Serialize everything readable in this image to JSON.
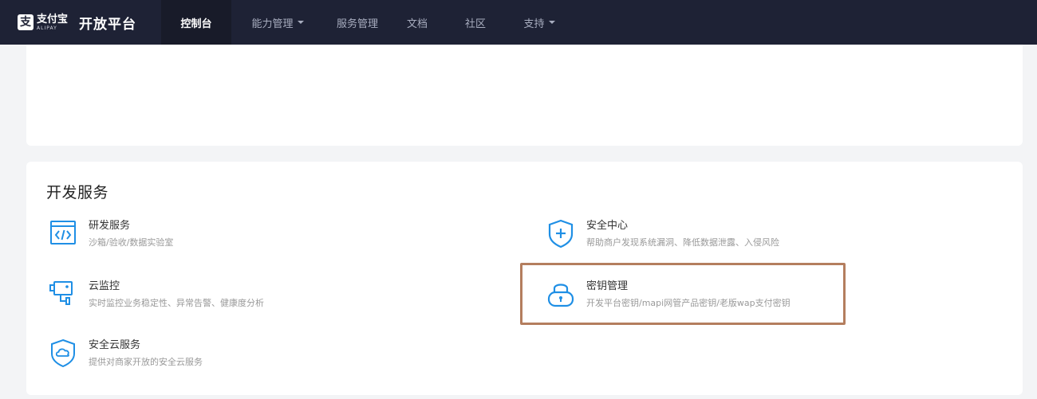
{
  "header": {
    "logo": {
      "cn": "支付宝",
      "en": "ALIPAY",
      "mark": "支"
    },
    "title": "开放平台",
    "nav": [
      {
        "label": "控制台",
        "active": true,
        "dropdown": false
      },
      {
        "label": "能力管理",
        "active": false,
        "dropdown": true
      },
      {
        "label": "服务管理",
        "active": false,
        "dropdown": false
      },
      {
        "label": "文档",
        "active": false,
        "dropdown": false
      },
      {
        "label": "社区",
        "active": false,
        "dropdown": false
      },
      {
        "label": "支持",
        "active": false,
        "dropdown": true
      }
    ]
  },
  "dev_services": {
    "title": "开发服务",
    "items": [
      {
        "title": "研发服务",
        "desc": "沙箱/验收/数据实验室",
        "icon": "code-window-icon"
      },
      {
        "title": "云监控",
        "desc": "实时监控业务稳定性、异常告警、健康度分析",
        "icon": "monitor-camera-icon"
      },
      {
        "title": "安全云服务",
        "desc": "提供对商家开放的安全云服务",
        "icon": "shield-cloud-icon"
      },
      {
        "title": "安全中心",
        "desc": "帮助商户发现系统漏洞、降低数据泄露、入侵风险",
        "icon": "shield-plus-icon"
      },
      {
        "title": "密钥管理",
        "desc": "开发平台密钥/mapi网管产品密钥/老版wap支付密钥",
        "icon": "lock-icon"
      }
    ]
  },
  "colors": {
    "nav_bg": "#1e2235",
    "nav_active_bg": "#181b29",
    "icon_blue": "#1f8fe5",
    "highlight": "#b47e5e"
  }
}
